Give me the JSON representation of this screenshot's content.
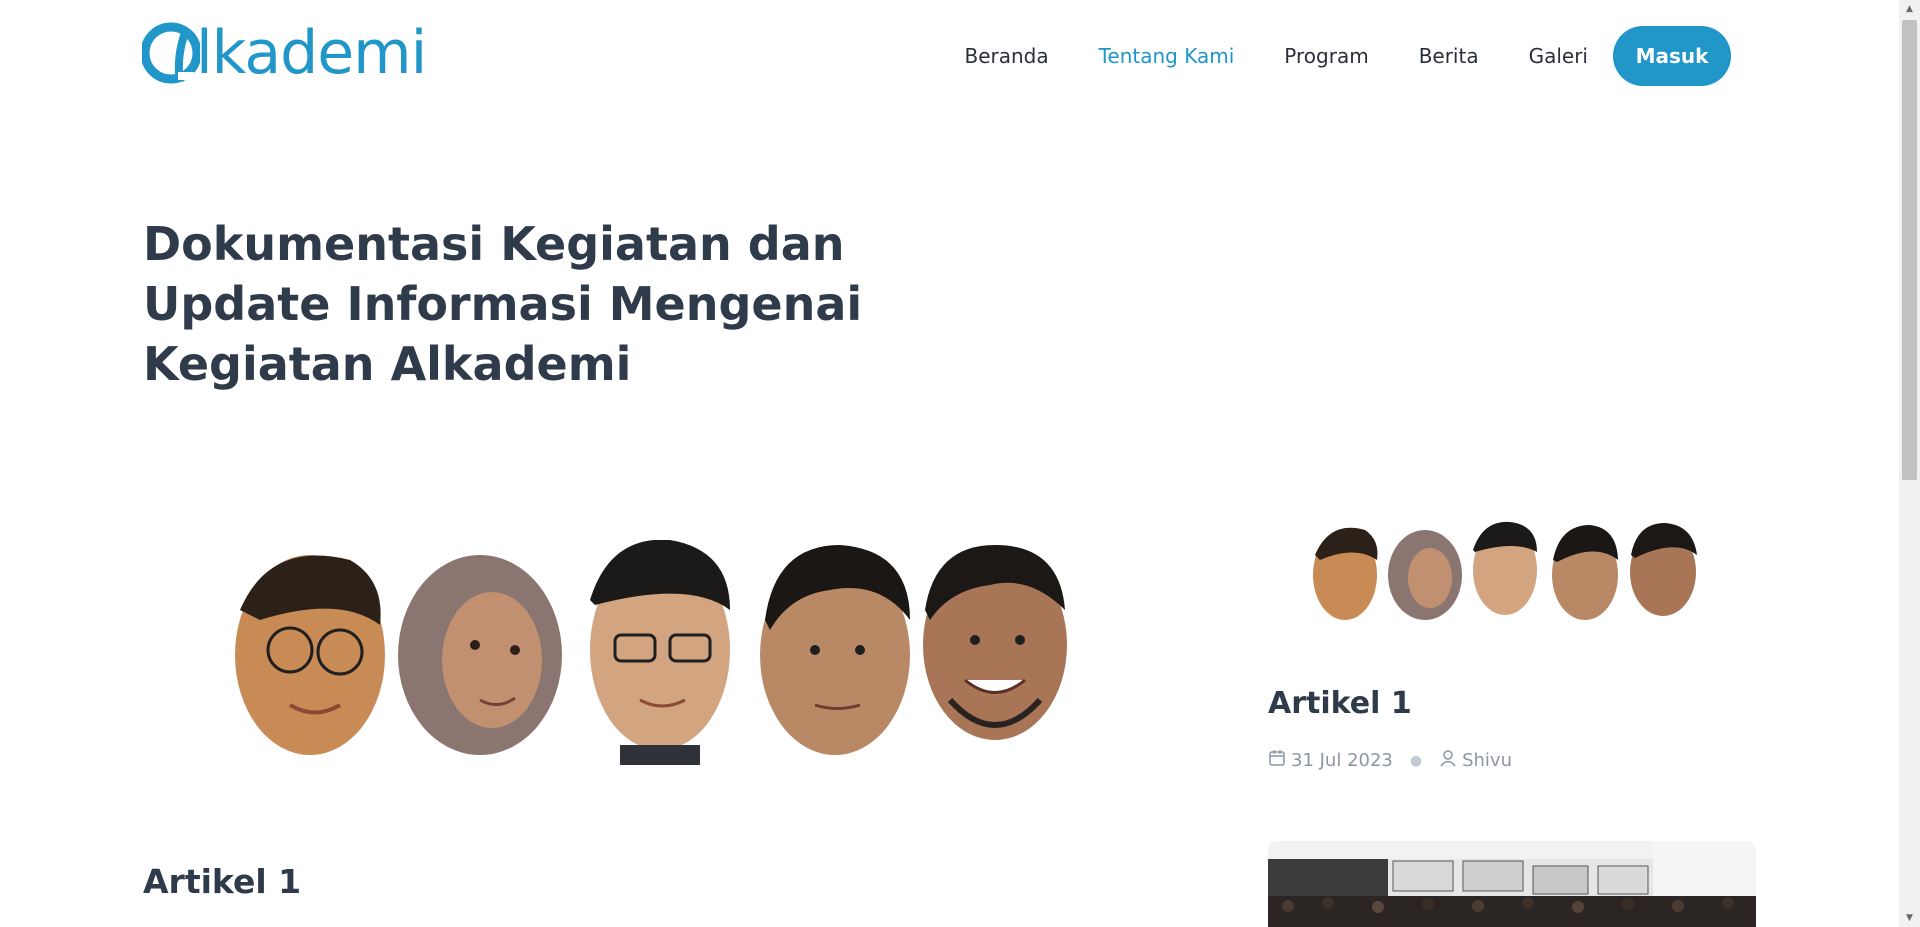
{
  "header": {
    "logo_text": "lkademi",
    "nav": [
      {
        "label": "Beranda",
        "active": false
      },
      {
        "label": "Tentang Kami",
        "active": true
      },
      {
        "label": "Program",
        "active": false
      },
      {
        "label": "Berita",
        "active": false
      },
      {
        "label": "Galeri",
        "active": false
      }
    ],
    "login_button": "Masuk"
  },
  "hero": {
    "title": "Dokumentasi Kegiatan dan Update Informasi Mengenai Kegiatan Alkademi"
  },
  "main": {
    "article_title": "Artikel 1"
  },
  "sidebar": {
    "article_title": "Artikel 1",
    "date": "31 Jul 2023",
    "author": "Shivu"
  },
  "colors": {
    "brand": "#2196c9",
    "heading": "#2f3a4a",
    "meta": "#8b95a5"
  }
}
